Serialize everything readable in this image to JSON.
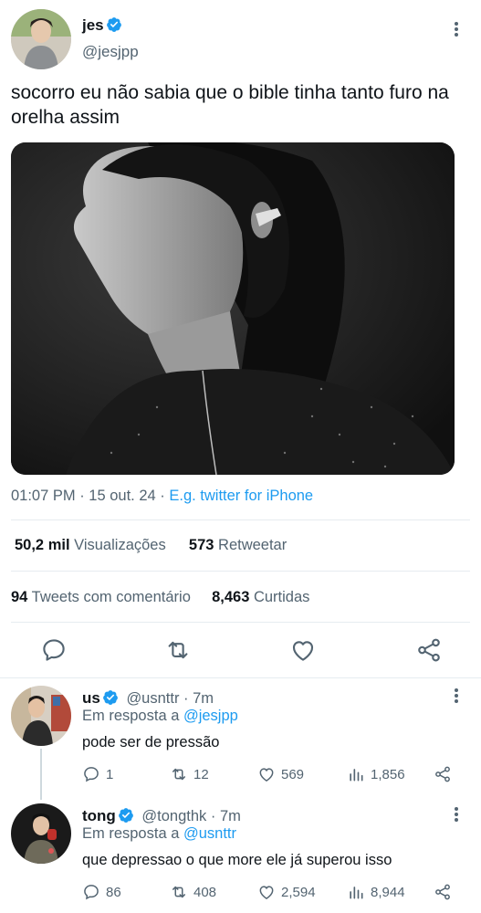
{
  "tweet": {
    "author_name": "jes",
    "author_handle": "@jesjpp",
    "text": "socorro eu não sabia que o bible tinha tanto furo na orelha assim",
    "time": "01:07 PM · 15 out. 24 · ",
    "source": "E.g. twitter for iPhone",
    "views_count": "50,2 mil",
    "views_label": " Visualizações",
    "retweets_count": "573",
    "retweets_label": " Retweetar",
    "quotes_count": "94",
    "quotes_label": " Tweets com comentário",
    "likes_count": "8,463",
    "likes_label": " Curtidas"
  },
  "replies": [
    {
      "name": "us",
      "handle": "@usnttr",
      "time": " · 7m",
      "reply_prefix": "Em resposta a ",
      "reply_to": "@jesjpp",
      "text": "pode ser de pressão",
      "comments": "1",
      "retweets": "12",
      "likes": "569",
      "views": "1,856"
    },
    {
      "name": "tong",
      "handle": "@tongthk",
      "time": " · 7m",
      "reply_prefix": "Em resposta a ",
      "reply_to": "@usnttr",
      "text": "que depressao o que more ele já superou isso",
      "comments": "86",
      "retweets": "408",
      "likes": "2,594",
      "views": "8,944"
    }
  ],
  "icons": {
    "verified": "verified-badge-icon",
    "more": "more-vertical-icon",
    "reply": "reply-icon",
    "retweet": "retweet-icon",
    "like": "heart-icon",
    "share": "share-icon",
    "views": "views-bar-chart-icon"
  },
  "colors": {
    "accent": "#1d9bf0",
    "text": "#0f1419",
    "muted": "#536471"
  }
}
